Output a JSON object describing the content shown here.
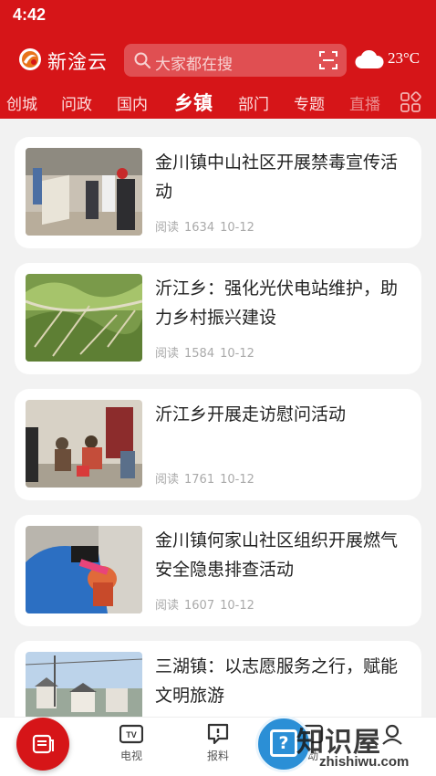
{
  "status_bar": {
    "time": "4:42"
  },
  "header": {
    "app_name": "新淦云",
    "search_placeholder": "大家都在搜",
    "weather_temp": "23°C",
    "weather_icon": "cloud-icon"
  },
  "nav": {
    "tabs": [
      {
        "label": "创城",
        "active": false
      },
      {
        "label": "问政",
        "active": false
      },
      {
        "label": "国内",
        "active": false
      },
      {
        "label": "乡镇",
        "active": true
      },
      {
        "label": "部门",
        "active": false
      },
      {
        "label": "专题",
        "active": false
      },
      {
        "label": "直播",
        "active": false
      }
    ]
  },
  "articles": [
    {
      "title": "金川镇中山社区开展禁毒宣传活动",
      "reads_label": "阅读",
      "reads": "1634",
      "date": "10-12"
    },
    {
      "title": "沂江乡：强化光伏电站维护，助力乡村振兴建设",
      "reads_label": "阅读",
      "reads": "1584",
      "date": "10-12"
    },
    {
      "title": "沂江乡开展走访慰问活动",
      "reads_label": "阅读",
      "reads": "1761",
      "date": "10-12"
    },
    {
      "title": "金川镇何家山社区组织开展燃气安全隐患排查活动",
      "reads_label": "阅读",
      "reads": "1607",
      "date": "10-12"
    },
    {
      "title": "三湖镇：以志愿服务之行，赋能文明旅游",
      "reads_label": "阅读",
      "reads": "",
      "date": ""
    }
  ],
  "tabbar": {
    "items": [
      {
        "label": "",
        "icon": "news-icon"
      },
      {
        "label": "电视",
        "icon": "tv-icon"
      },
      {
        "label": "报料",
        "icon": "report-icon"
      },
      {
        "label": "动",
        "icon": "activity-icon"
      },
      {
        "label": "",
        "icon": "user-icon"
      }
    ]
  },
  "watermark": {
    "text": "知识屋",
    "url_text": "zhishiwu.com",
    "symbol": "?"
  },
  "colors": {
    "brand_red": "#d61518",
    "watermark_blue": "#2b8fd6"
  }
}
